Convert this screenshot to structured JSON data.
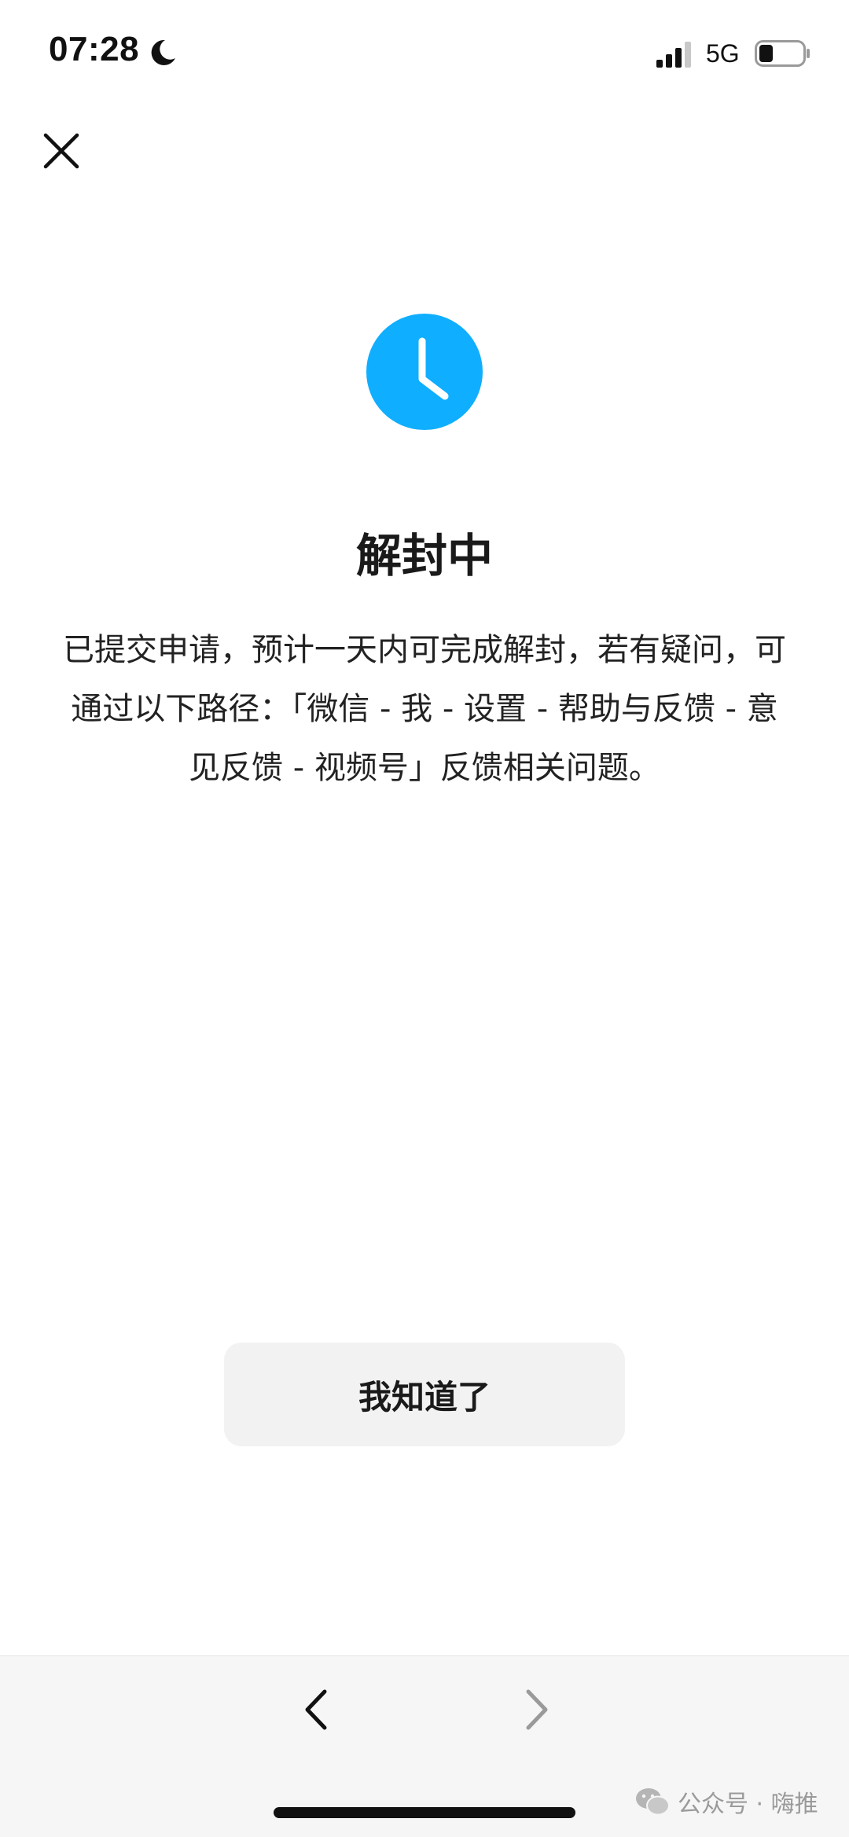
{
  "status_bar": {
    "time": "07:28",
    "network": "5G",
    "icons": [
      "moon-icon",
      "signal-icon",
      "battery-icon"
    ]
  },
  "header": {
    "close_icon": "close-icon"
  },
  "status_icon": {
    "name": "clock-icon",
    "color": "#10AEFF"
  },
  "main": {
    "title": "解封中",
    "description": "已提交申请，预计一天内可完成解封，若有疑问，可通过以下路径：「微信 - 我 - 设置 - 帮助与反馈 - 意见反馈 - 视频号」反馈相关问题。",
    "button_label": "我知道了"
  },
  "bottom_nav": {
    "back_icon": "chevron-left-icon",
    "forward_icon": "chevron-right-icon"
  },
  "watermark": {
    "text": "公众号 · 嗨推"
  }
}
